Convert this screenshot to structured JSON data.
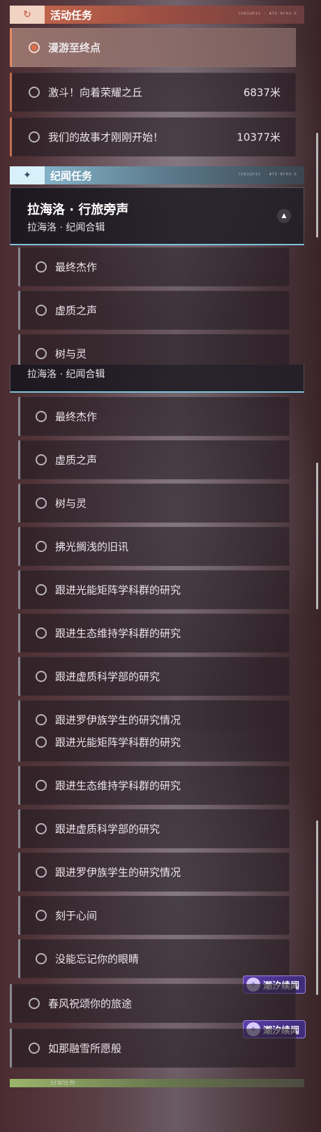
{
  "active_section": {
    "title": "活动任务",
    "icon": "return-arrow-icon",
    "deco": "ΞΛΘΙΩΡΙΛ · ΦΤΣ·ΒΓΚΛ·Ε",
    "items": [
      {
        "label": "漫游至终点",
        "distance": "",
        "selected": true
      },
      {
        "label": "激斗！向着荣耀之丘",
        "distance": "6837米",
        "selected": false
      },
      {
        "label": "我们的故事才刚刚开始！",
        "distance": "10377米",
        "selected": false
      }
    ]
  },
  "story_section": {
    "title": "纪闻任务",
    "icon": "sparkle-icon",
    "deco": "ΞΛΘΙΩΡΙΛ · ΦΤΣ·ΒΓΚΛ·Ε",
    "card_title": "拉海洛 · 行旅旁声",
    "card_subtitle": "拉海洛 · 纪闻合辑"
  },
  "quests": {
    "q1": "最终杰作",
    "q2": "虚质之声",
    "q3": "树与灵",
    "q4": "拂光搁浅的旧讯",
    "q5": "跟进光能矩阵学科群的研究",
    "q6": "跟进生态维持学科群的研究",
    "q7": "跟进虚质科学部的研究",
    "q8": "跟进罗伊族学生的研究情况",
    "q9": "刻于心间",
    "q10": "没能忘记你的眼睛",
    "q11": "春风祝颂你的旅途",
    "q12": "如那融雪所愿般"
  },
  "badge": {
    "label": "潮汐续闻",
    "icon": "wave-swirl-icon"
  },
  "next_section_partial": "日常任务",
  "colors": {
    "active_accent": "#c96a4e",
    "story_accent": "#8fc2d9",
    "badge_purple": "#5b3ea8"
  }
}
